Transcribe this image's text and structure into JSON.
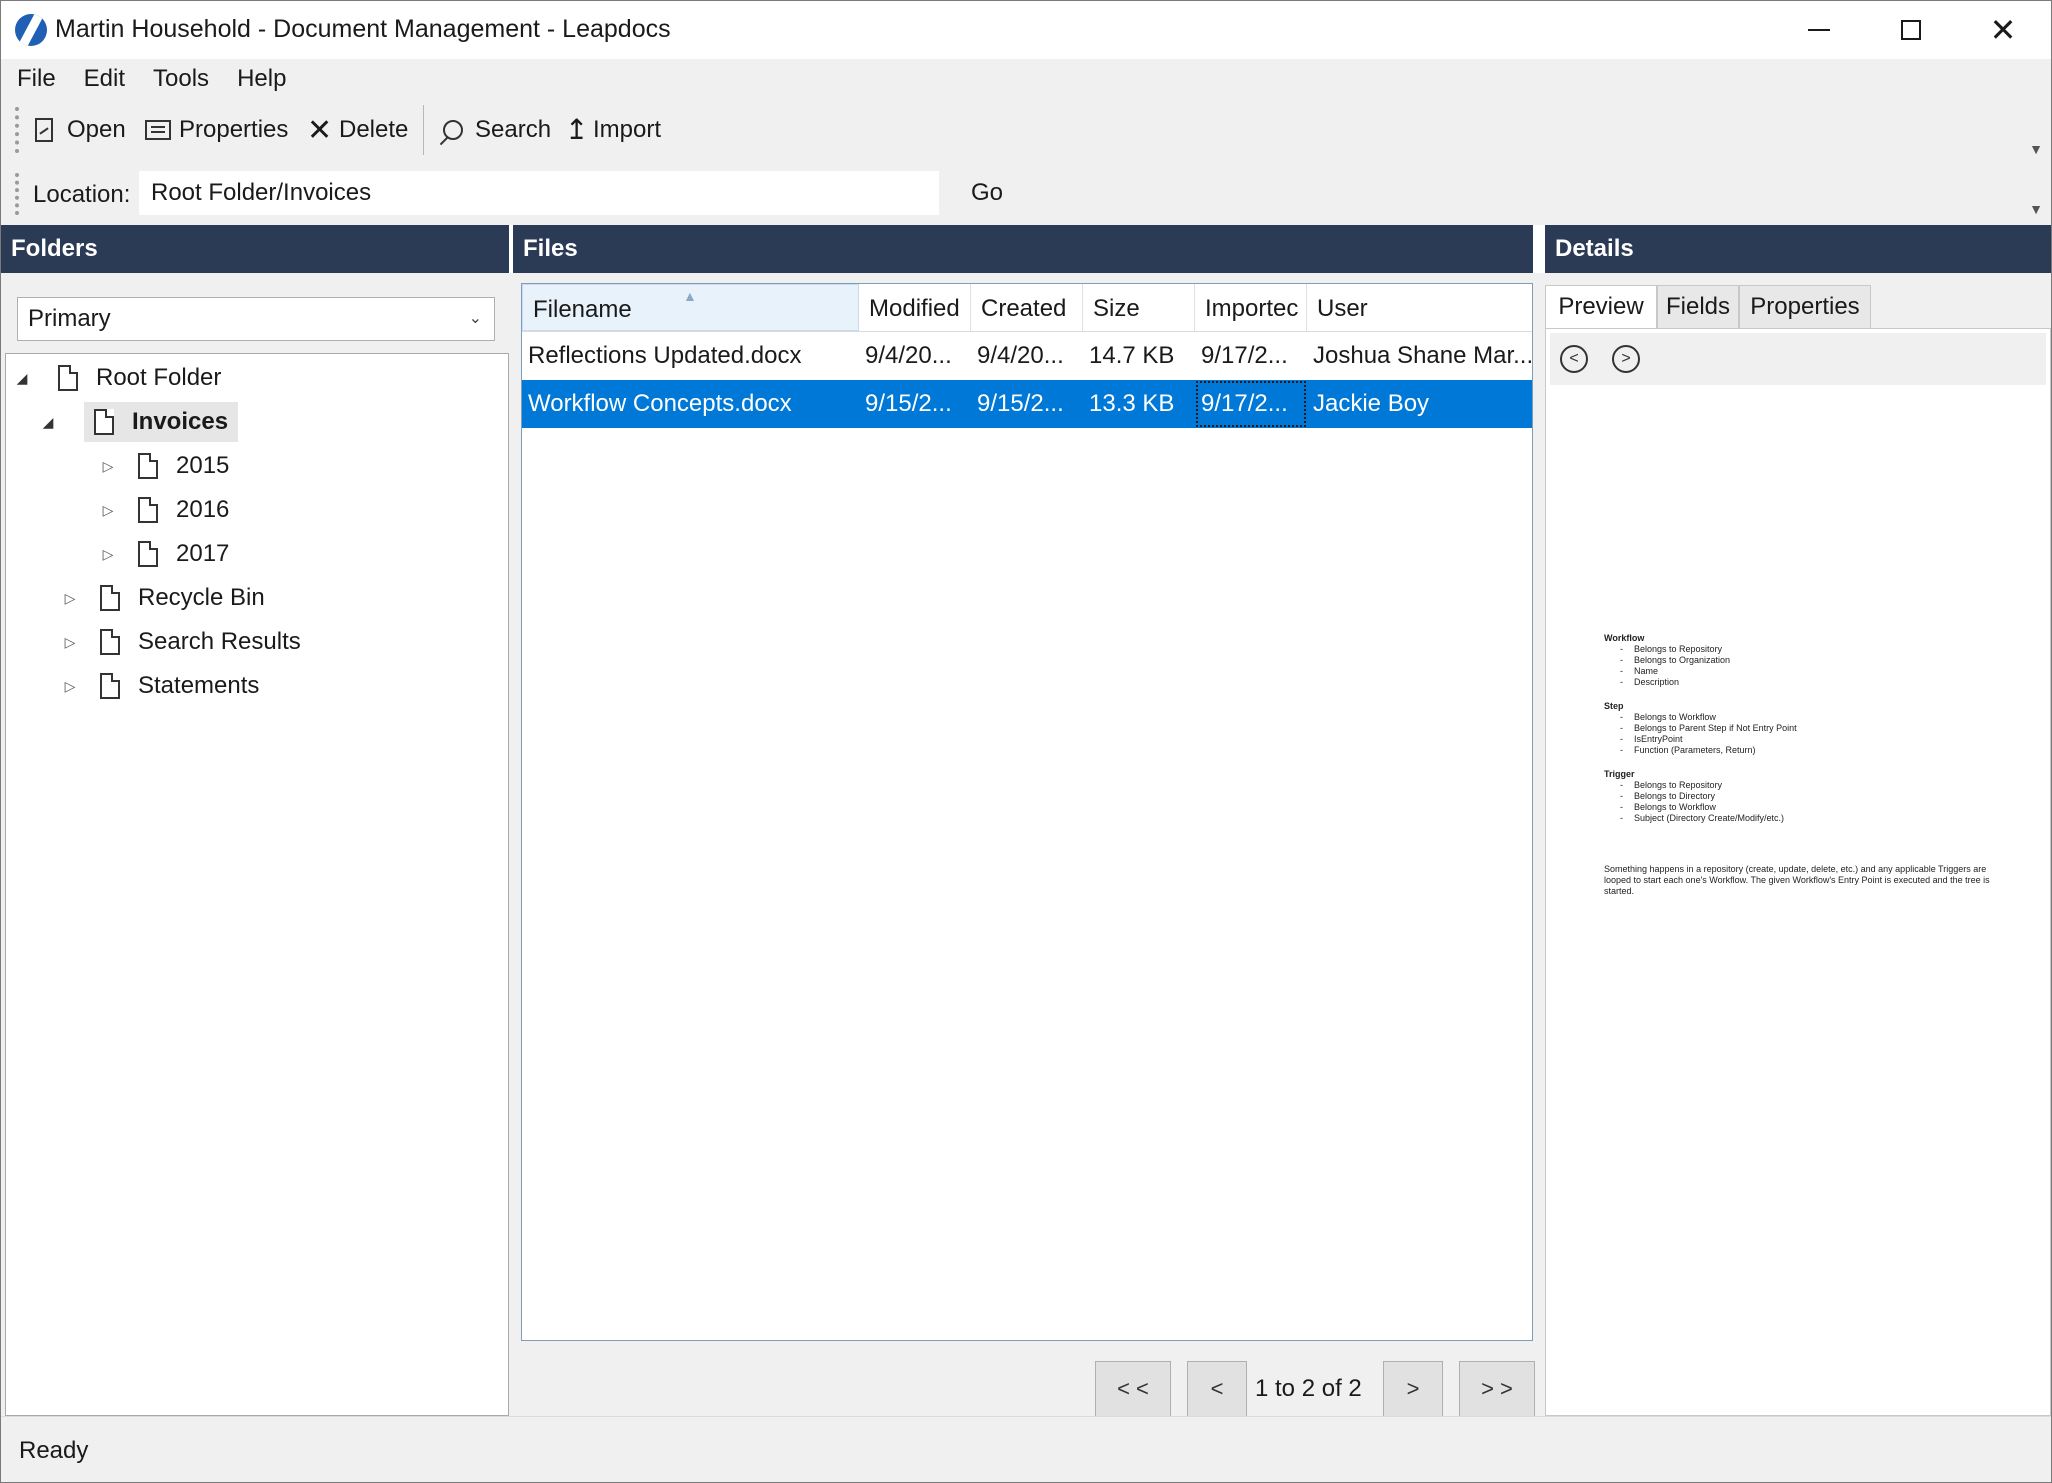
{
  "window": {
    "title": "Martin Household - Document Management - Leapdocs",
    "minimize_glyph": "",
    "close_glyph": "✕"
  },
  "menu": [
    "File",
    "Edit",
    "Tools",
    "Help"
  ],
  "toolbar": {
    "open_label": "Open",
    "properties_label": "Properties",
    "delete_label": "Delete",
    "search_label": "Search",
    "import_label": "Import"
  },
  "location": {
    "label": "Location:",
    "value": "Root Folder/Invoices",
    "go_label": "Go"
  },
  "folders": {
    "header": "Folders",
    "selected_repository": "Primary",
    "tree": {
      "root": "Root Folder",
      "invoices": "Invoices",
      "y2015": "2015",
      "y2016": "2016",
      "y2017": "2017",
      "recycle_bin": "Recycle Bin",
      "search_results": "Search Results",
      "statements": "Statements"
    }
  },
  "files": {
    "header": "Files",
    "columns": [
      "Filename",
      "Modified",
      "Created",
      "Size",
      "Importec",
      "User"
    ],
    "rows": [
      {
        "filename": "Reflections Updated.docx",
        "modified": "9/4/20...",
        "created": "9/4/20...",
        "size": "14.7 KB",
        "imported": "9/17/2...",
        "user": "Joshua Shane Mar..."
      },
      {
        "filename": "Workflow Concepts.docx",
        "modified": "9/15/2...",
        "created": "9/15/2...",
        "size": "13.3 KB",
        "imported": "9/17/2...",
        "user": "Jackie Boy"
      }
    ],
    "pager": {
      "first": "< <",
      "prev": "<",
      "status": "1 to 2 of 2",
      "next": ">",
      "last": "> >"
    }
  },
  "details": {
    "header": "Details",
    "tabs": [
      "Preview",
      "Fields",
      "Properties"
    ],
    "preview_doc": {
      "workflow_h": "Workflow",
      "workflow_items": [
        "Belongs to Repository",
        "Belongs to Organization",
        "Name",
        "Description"
      ],
      "step_h": "Step",
      "step_items": [
        "Belongs to Workflow",
        "Belongs to Parent Step if Not Entry Point",
        "IsEntryPoint",
        "Function (Parameters, Return)"
      ],
      "trigger_h": "Trigger",
      "trigger_items": [
        "Belongs to Repository",
        "Belongs to Directory",
        "Belongs to Workflow",
        "Subject (Directory Create/Modify/etc.)"
      ],
      "paragraph": "Something happens in a repository (create, update, delete, etc.) and any applicable Triggers are looped to start each one's Workflow. The given Workflow's Entry Point is executed and the tree is started."
    }
  },
  "status": "Ready",
  "colors": {
    "panel_header": "#2b3a55",
    "selection": "#0078d7",
    "chrome": "#f0f0f0"
  }
}
